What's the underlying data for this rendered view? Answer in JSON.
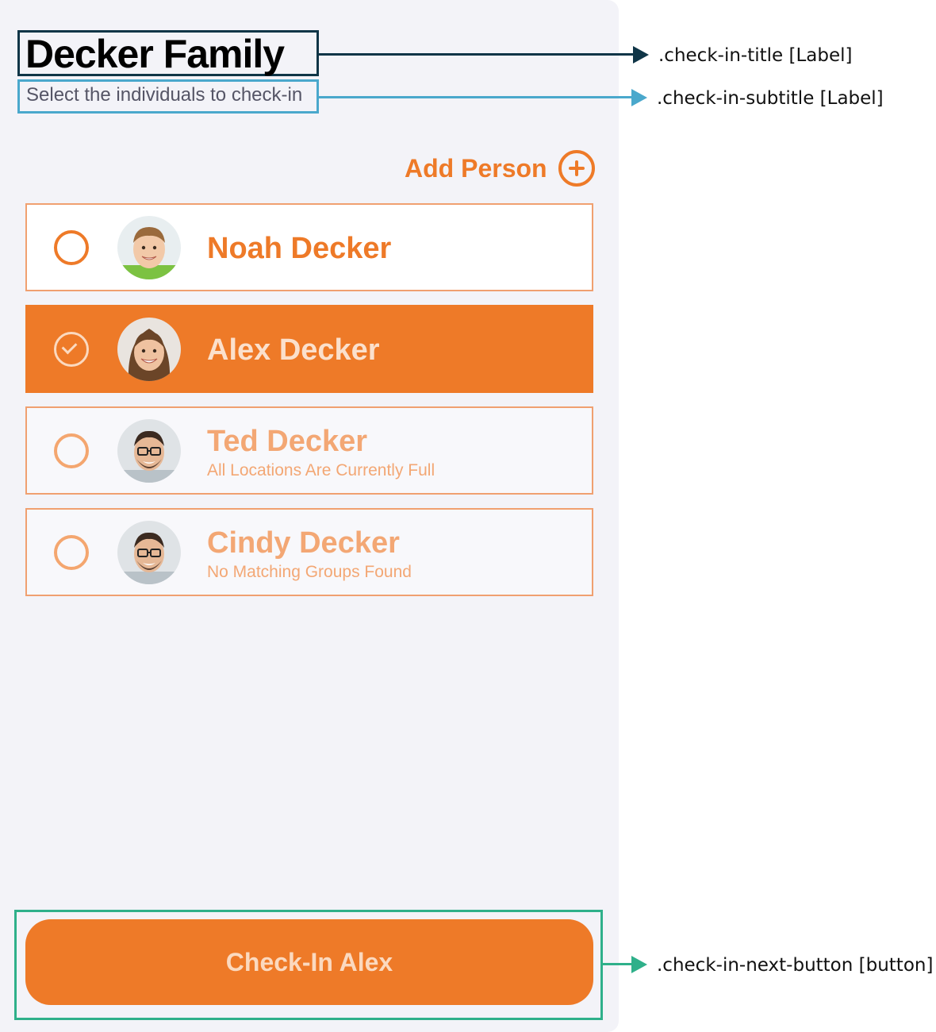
{
  "header": {
    "title": "Decker Family",
    "subtitle": "Select the individuals to check-in"
  },
  "add_person": {
    "label": "Add Person",
    "icon": "plus-circle-icon"
  },
  "people": [
    {
      "name": "Noah Decker",
      "status": "",
      "selected": false,
      "available": true
    },
    {
      "name": "Alex Decker",
      "status": "",
      "selected": true,
      "available": true
    },
    {
      "name": "Ted Decker",
      "status": "All Locations Are Currently Full",
      "selected": false,
      "available": false
    },
    {
      "name": "Cindy Decker",
      "status": "No Matching Groups Found",
      "selected": false,
      "available": false
    }
  ],
  "next_button": {
    "label": "Check-In Alex"
  },
  "annotations": {
    "title": ".check-in-title [Label]",
    "subtitle": ".check-in-subtitle [Label]",
    "button": ".check-in-next-button [button]"
  },
  "colors": {
    "accent": "#ee7a28",
    "background": "#f3f3f8",
    "title_annotation": "#0f3547",
    "subtitle_annotation": "#4aa8cc",
    "button_annotation": "#2fb08a"
  }
}
